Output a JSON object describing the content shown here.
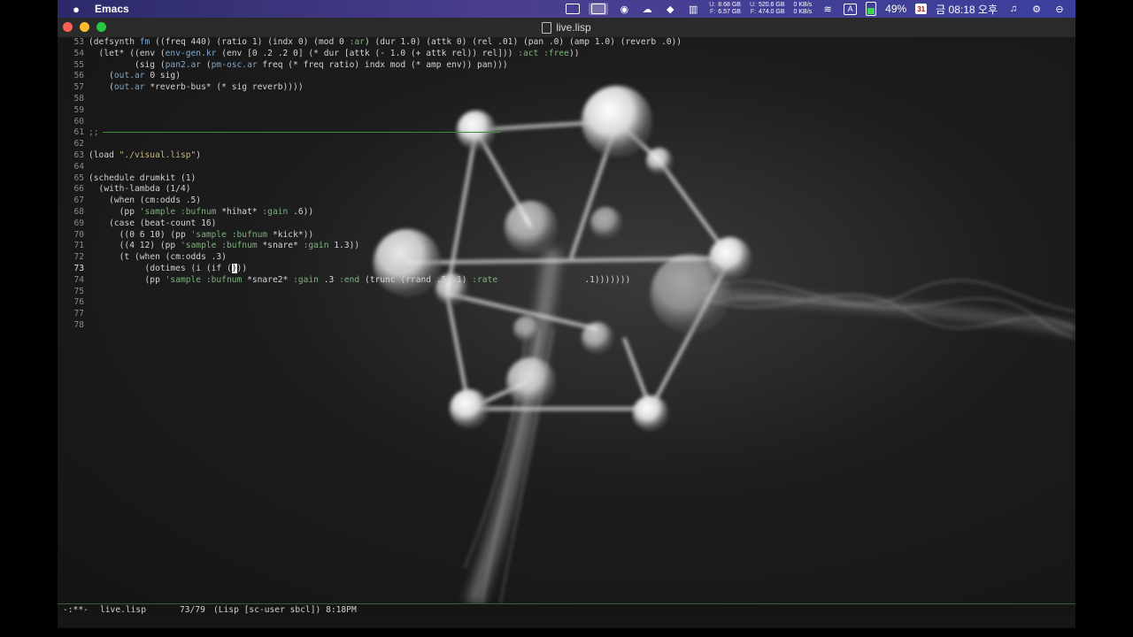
{
  "menubar": {
    "app_name": "Emacs",
    "mem_labels": [
      "U:",
      "F:"
    ],
    "mem_values": [
      "8.68 GB",
      "6.57 GB"
    ],
    "disk_labels": [
      "U:",
      "F:"
    ],
    "disk_values": [
      "520.6 GB",
      "474.0 GB"
    ],
    "net_values": [
      "0 KB/s",
      "0 KB/s"
    ],
    "input_source": "A",
    "battery": "49%",
    "battery_level": 0.49,
    "calendar_day": "31",
    "clock": "금 08:18 오후"
  },
  "window": {
    "title": "live.lisp"
  },
  "editor": {
    "lines": [
      {
        "n": "53",
        "html": "(<span class='kw'>defsynth</span> <span class='fn'>fm</span> ((freq 440) (ratio 1) (indx 0) (mod 0 <span class='sym'>:ar</span>) (dur 1.0) (attk 0) (rel .01) (pan .0) (amp 1.0) (reverb .0))"
      },
      {
        "n": "54",
        "html": "  (<span class='kw'>let*</span> ((env (<span class='fn'>env-gen.kr</span> (env [0 .2 .2 0] (* dur [attk (- 1.0 (+ attk rel)) rel])) <span class='sym'>:act :free</span>))"
      },
      {
        "n": "55",
        "html": "         (sig (<span class='fn'>pan2.ar</span> (<span class='fn'>pm-osc.ar</span> freq (* freq ratio) indx mod (* amp env)) pan)))"
      },
      {
        "n": "56",
        "html": "    (<span class='fn'>out.ar</span> 0 sig)"
      },
      {
        "n": "57",
        "html": "    (<span class='fn'>out.ar</span> *reverb-bus* (* sig reverb))))"
      },
      {
        "n": "58",
        "html": ""
      },
      {
        "n": "59",
        "html": ""
      },
      {
        "n": "60",
        "html": ""
      },
      {
        "n": "61",
        "html": "<span class='cmt'>;;</span><span class='sepline'></span>"
      },
      {
        "n": "62",
        "html": ""
      },
      {
        "n": "63",
        "html": "(load <span class='str'>\"./visual.lisp\"</span>)"
      },
      {
        "n": "64",
        "html": ""
      },
      {
        "n": "65",
        "html": "(<span class='kw'>schedule</span> drumkit (1)"
      },
      {
        "n": "66",
        "html": "  (<span class='kw'>with-lambda</span> (1/4)"
      },
      {
        "n": "67",
        "html": "    (<span class='kw'>when</span> (cm:odds .5)"
      },
      {
        "n": "68",
        "html": "      (pp <span class='sym'>'sample</span> <span class='sym'>:bufnum</span> *hihat* <span class='sym'>:gain</span> .6))"
      },
      {
        "n": "69",
        "html": "    (<span class='kw'>case</span> (beat-count 16)"
      },
      {
        "n": "70",
        "html": "      ((0 6 10) (pp <span class='sym'>'sample</span> <span class='sym'>:bufnum</span> *kick*))"
      },
      {
        "n": "71",
        "html": "      ((4 12) (pp <span class='sym'>'sample</span> <span class='sym'>:bufnum</span> *snare* <span class='sym'>:gain</span> 1.3))"
      },
      {
        "n": "72",
        "html": "      (t (<span class='kw'>when</span> (cm:odds .3)"
      },
      {
        "n": "73",
        "html": "           (<span class='kw'>dotimes</span> (i (<span class='kw'>if</span> (<span class='cursor'>)</span>))"
      },
      {
        "n": "74",
        "html": "           (pp <span class='sym'>'sample</span> <span class='sym'>:bufnum</span> *snare2* <span class='sym'>:gain</span> .3 <span class='sym'>:end</span> (trunc (rrand .5 .1) <span class='sym'>:rate</span>                 .1)))))))"
      },
      {
        "n": "75",
        "html": ""
      },
      {
        "n": "76",
        "html": ""
      },
      {
        "n": "77",
        "html": ""
      },
      {
        "n": "78",
        "html": ""
      }
    ],
    "current_line": "73"
  },
  "modeline": {
    "status": "-:**-",
    "buffer": "live.lisp",
    "position": "73/79",
    "modes": "(Lisp [sc-user sbcl]) 8:18PM"
  }
}
